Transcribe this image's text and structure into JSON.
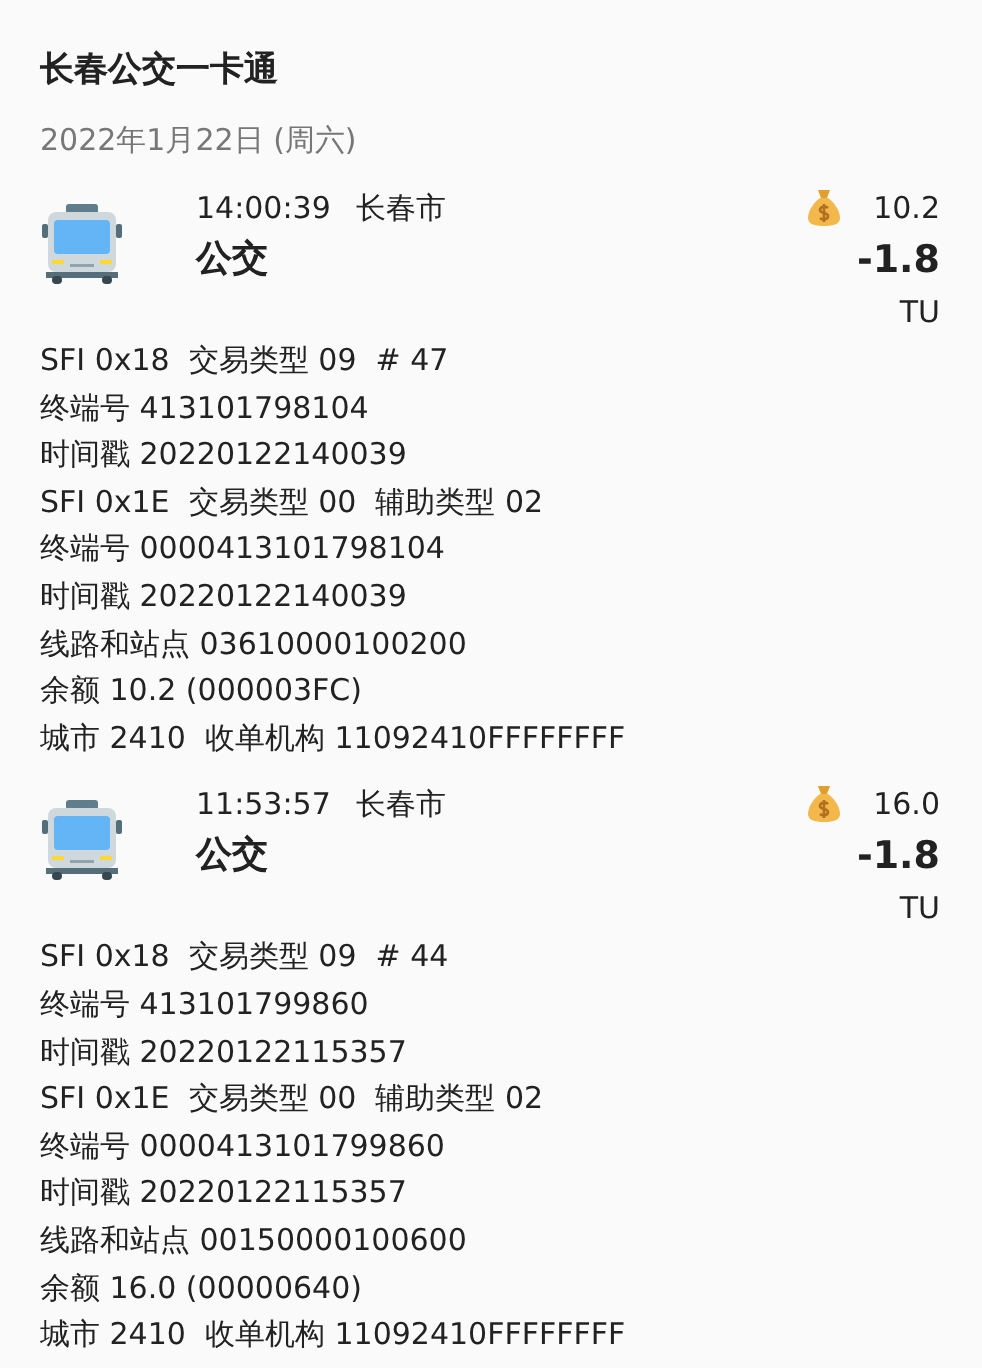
{
  "title": "长春公交一卡通",
  "date": "2022年1月22日 (周六)",
  "transactions": [
    {
      "time": "14:00:39",
      "city": "长春市",
      "kind": "bus",
      "type": "公交",
      "balance": "10.2",
      "amount": "-1.8",
      "unit": "TU",
      "details": [
        "SFI 0x18  交易类型 09  # 47",
        "终端号 413101798104",
        "时间戳 20220122140039",
        "SFI 0x1E  交易类型 00  辅助类型 02",
        "终端号 0000413101798104",
        "时间戳 20220122140039",
        "线路和站点 03610000100200",
        "余额 10.2 (000003FC)",
        "城市 2410  收单机构 11092410FFFFFFFF"
      ]
    },
    {
      "time": "11:53:57",
      "city": "长春市",
      "kind": "bus",
      "type": "公交",
      "balance": "16.0",
      "amount": "-1.8",
      "unit": "TU",
      "details": [
        "SFI 0x18  交易类型 09  # 44",
        "终端号 413101799860",
        "时间戳 20220122115357",
        "SFI 0x1E  交易类型 00  辅助类型 02",
        "终端号 0000413101799860",
        "时间戳 20220122115357",
        "线路和站点 00150000100600",
        "余额 16.0 (00000640)",
        "城市 2410  收单机构 11092410FFFFFFFF"
      ]
    }
  ]
}
